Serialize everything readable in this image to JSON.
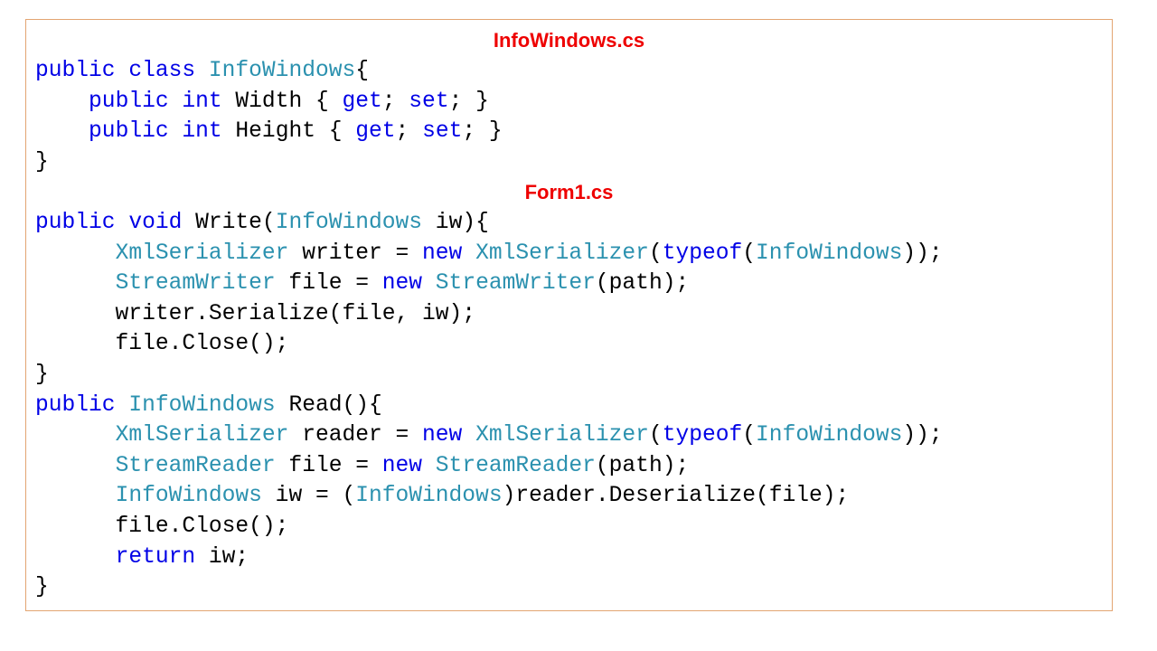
{
  "colors": {
    "keyword": "#0000e6",
    "type": "#2b91af",
    "plain": "#000000",
    "title": "#ee0000",
    "border": "#e3a572"
  },
  "sections": [
    {
      "title": "InfoWindows.cs",
      "lines": [
        [
          [
            "kw",
            "public"
          ],
          [
            "plain",
            " "
          ],
          [
            "kw",
            "class"
          ],
          [
            "plain",
            " "
          ],
          [
            "type",
            "InfoWindows"
          ],
          [
            "plain",
            "{"
          ]
        ],
        [
          [
            "plain",
            "    "
          ],
          [
            "kw",
            "public"
          ],
          [
            "plain",
            " "
          ],
          [
            "kw",
            "int"
          ],
          [
            "plain",
            " Width { "
          ],
          [
            "kw",
            "get"
          ],
          [
            "plain",
            "; "
          ],
          [
            "kw",
            "set"
          ],
          [
            "plain",
            "; }"
          ]
        ],
        [
          [
            "plain",
            "    "
          ],
          [
            "kw",
            "public"
          ],
          [
            "plain",
            " "
          ],
          [
            "kw",
            "int"
          ],
          [
            "plain",
            " Height { "
          ],
          [
            "kw",
            "get"
          ],
          [
            "plain",
            "; "
          ],
          [
            "kw",
            "set"
          ],
          [
            "plain",
            "; }"
          ]
        ],
        [
          [
            "plain",
            "}"
          ]
        ]
      ]
    },
    {
      "title": "Form1.cs",
      "lines": [
        [
          [
            "kw",
            "public"
          ],
          [
            "plain",
            " "
          ],
          [
            "kw",
            "void"
          ],
          [
            "plain",
            " Write("
          ],
          [
            "type",
            "InfoWindows"
          ],
          [
            "plain",
            " iw){"
          ]
        ],
        [
          [
            "plain",
            "      "
          ],
          [
            "type",
            "XmlSerializer"
          ],
          [
            "plain",
            " writer = "
          ],
          [
            "kw",
            "new"
          ],
          [
            "plain",
            " "
          ],
          [
            "type",
            "XmlSerializer"
          ],
          [
            "plain",
            "("
          ],
          [
            "kw",
            "typeof"
          ],
          [
            "plain",
            "("
          ],
          [
            "type",
            "InfoWindows"
          ],
          [
            "plain",
            "));"
          ]
        ],
        [
          [
            "plain",
            "      "
          ],
          [
            "type",
            "StreamWriter"
          ],
          [
            "plain",
            " file = "
          ],
          [
            "kw",
            "new"
          ],
          [
            "plain",
            " "
          ],
          [
            "type",
            "StreamWriter"
          ],
          [
            "plain",
            "(path);"
          ]
        ],
        [
          [
            "plain",
            "      writer.Serialize(file, iw);"
          ]
        ],
        [
          [
            "plain",
            "      file.Close();"
          ]
        ],
        [
          [
            "plain",
            "}"
          ]
        ],
        [
          [
            "kw",
            "public"
          ],
          [
            "plain",
            " "
          ],
          [
            "type",
            "InfoWindows"
          ],
          [
            "plain",
            " Read(){"
          ]
        ],
        [
          [
            "plain",
            "      "
          ],
          [
            "type",
            "XmlSerializer"
          ],
          [
            "plain",
            " reader = "
          ],
          [
            "kw",
            "new"
          ],
          [
            "plain",
            " "
          ],
          [
            "type",
            "XmlSerializer"
          ],
          [
            "plain",
            "("
          ],
          [
            "kw",
            "typeof"
          ],
          [
            "plain",
            "("
          ],
          [
            "type",
            "InfoWindows"
          ],
          [
            "plain",
            "));"
          ]
        ],
        [
          [
            "plain",
            "      "
          ],
          [
            "type",
            "StreamReader"
          ],
          [
            "plain",
            " file = "
          ],
          [
            "kw",
            "new"
          ],
          [
            "plain",
            " "
          ],
          [
            "type",
            "StreamReader"
          ],
          [
            "plain",
            "(path);"
          ]
        ],
        [
          [
            "plain",
            "      "
          ],
          [
            "type",
            "InfoWindows"
          ],
          [
            "plain",
            " iw = ("
          ],
          [
            "type",
            "InfoWindows"
          ],
          [
            "plain",
            ")reader.Deserialize(file);"
          ]
        ],
        [
          [
            "plain",
            "      file.Close();"
          ]
        ],
        [
          [
            "plain",
            "      "
          ],
          [
            "kw",
            "return"
          ],
          [
            "plain",
            " iw;"
          ]
        ],
        [
          [
            "plain",
            "}"
          ]
        ]
      ]
    }
  ]
}
